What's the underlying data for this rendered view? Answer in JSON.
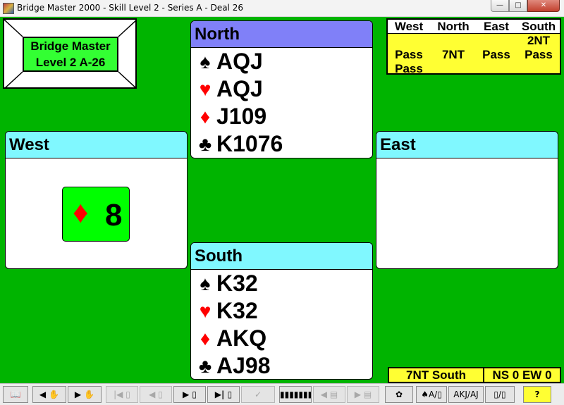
{
  "window": {
    "title": "Bridge Master 2000 - Skill Level 2 - Series A - Deal 26",
    "minimize": "—",
    "maximize": "□",
    "close": "✕"
  },
  "logo": {
    "line1": "Bridge Master",
    "line2": "Level 2 A-26"
  },
  "hands": {
    "north": {
      "label": "North",
      "spades": "AQJ",
      "hearts": "AQJ",
      "diamonds": "J109",
      "clubs": "K1076"
    },
    "south": {
      "label": "South",
      "spades": "K32",
      "hearts": "K32",
      "diamonds": "AKQ",
      "clubs": "AJ98"
    },
    "west": {
      "label": "West",
      "played_card": {
        "suit": "diamonds",
        "rank": "8"
      }
    },
    "east": {
      "label": "East"
    }
  },
  "suit_symbols": {
    "spade": "♠",
    "heart": "♥",
    "diamond": "♦",
    "club": "♣"
  },
  "bidding": {
    "headers": [
      "West",
      "North",
      "East",
      "South"
    ],
    "calls": [
      "2NT",
      "Pass",
      "7NT",
      "Pass",
      "Pass",
      "Pass"
    ]
  },
  "status": {
    "contract": "7NT South",
    "score": "NS 0 EW 0"
  },
  "toolbar": {
    "book": "📖",
    "prev_trick": "◀ ✋",
    "next_trick": "▶ ✋",
    "first_card": "|◀ ▯",
    "prev_card": "◀ ▯",
    "play_card": "▶ ▯",
    "last_card": "▶| ▯",
    "claim": "✓",
    "hand_strip": "▮▮▮▮▮▮▮▮",
    "prev_deal": "◀ ▤",
    "next_deal": "▶ ▤",
    "settings": "✿",
    "spade_a": "♠A/▯",
    "akj": "AKJ/AJ",
    "swap": "▯/▯",
    "help": "?"
  },
  "colors": {
    "felt": "#00b400",
    "header_cyan": "#80f8ff",
    "header_blue": "#8080f8",
    "panel_yellow": "#ffff33",
    "suit_red": "#ff0000",
    "played_card_green": "#00ff00"
  }
}
